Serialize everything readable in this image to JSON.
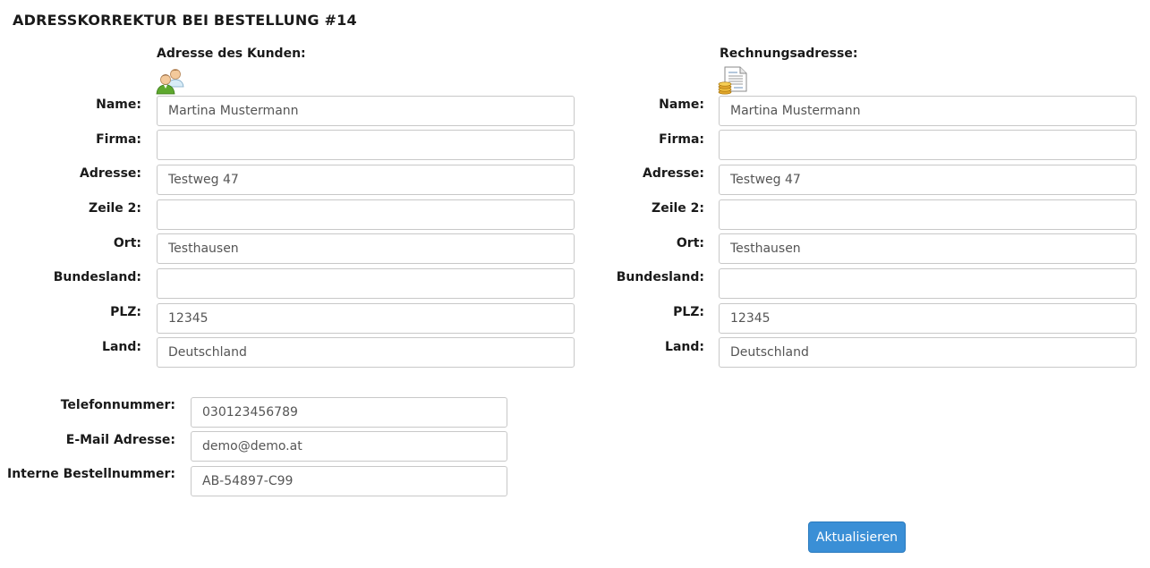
{
  "page": {
    "title": "ADRESSKORREKTUR BEI BESTELLUNG #14"
  },
  "customer_address": {
    "heading": "Adresse des Kunden:",
    "icon": "customers-icon",
    "fields": {
      "name": {
        "label": "Name:",
        "value": "Martina Mustermann"
      },
      "firma": {
        "label": "Firma:",
        "value": ""
      },
      "adresse": {
        "label": "Adresse:",
        "value": "Testweg 47"
      },
      "zeile2": {
        "label": "Zeile 2:",
        "value": ""
      },
      "ort": {
        "label": "Ort:",
        "value": "Testhausen"
      },
      "bundesland": {
        "label": "Bundesland:",
        "value": ""
      },
      "plz": {
        "label": "PLZ:",
        "value": "12345"
      },
      "land": {
        "label": "Land:",
        "value": "Deutschland"
      }
    }
  },
  "billing_address": {
    "heading": "Rechnungsadresse:",
    "icon": "invoice-coins-icon",
    "fields": {
      "name": {
        "label": "Name:",
        "value": "Martina Mustermann"
      },
      "firma": {
        "label": "Firma:",
        "value": ""
      },
      "adresse": {
        "label": "Adresse:",
        "value": "Testweg 47"
      },
      "zeile2": {
        "label": "Zeile 2:",
        "value": ""
      },
      "ort": {
        "label": "Ort:",
        "value": "Testhausen"
      },
      "bundesland": {
        "label": "Bundesland:",
        "value": ""
      },
      "plz": {
        "label": "PLZ:",
        "value": "12345"
      },
      "land": {
        "label": "Land:",
        "value": "Deutschland"
      }
    }
  },
  "contact": {
    "telefon": {
      "label": "Telefonnummer:",
      "value": "030123456789"
    },
    "email": {
      "label": "E-Mail Adresse:",
      "value": "demo@demo.at"
    },
    "bestellnummer": {
      "label": "Interne Bestellnummer:",
      "value": "AB-54897-C99"
    }
  },
  "actions": {
    "update_label": "Aktualisieren"
  },
  "colors": {
    "button_background": "#3a8fd6",
    "button_text": "#ffffff",
    "input_border": "#c8c8c8"
  }
}
